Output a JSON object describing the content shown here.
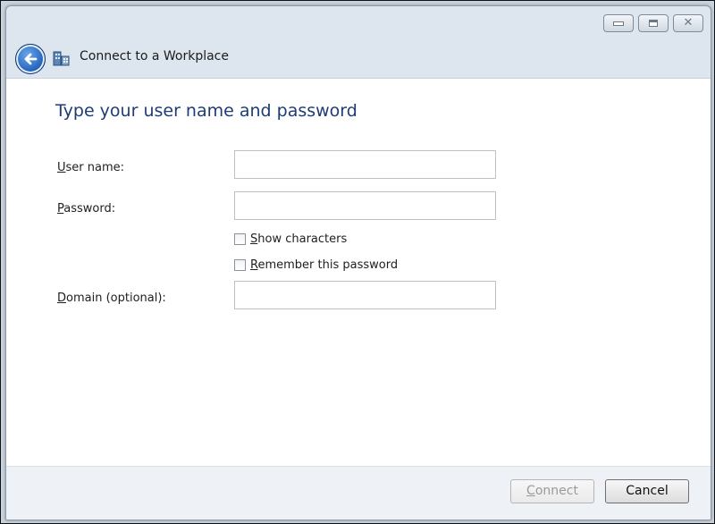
{
  "window": {
    "title": "Connect to a Workplace",
    "icons": {
      "back": "back-arrow-icon",
      "app": "network-workplace-icon",
      "minimize": "minimize-icon",
      "maximize": "maximize-icon",
      "close": "close-icon"
    }
  },
  "main": {
    "heading": "Type your user name and password",
    "username": {
      "label_access": "U",
      "label_rest": "ser name:",
      "value": ""
    },
    "password": {
      "label_access": "P",
      "label_rest": "assword:",
      "value": ""
    },
    "show_characters": {
      "label_access": "S",
      "label_rest": "how characters",
      "checked": false
    },
    "remember_password": {
      "label_access": "R",
      "label_rest": "emember this password",
      "checked": false
    },
    "domain": {
      "label_access": "D",
      "label_rest": "omain (optional):",
      "value": ""
    }
  },
  "footer": {
    "connect_access": "C",
    "connect_rest": "onnect",
    "connect_enabled": false,
    "cancel_label": "Cancel"
  }
}
